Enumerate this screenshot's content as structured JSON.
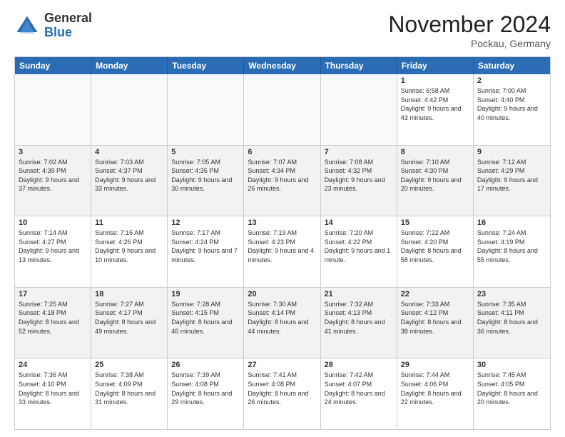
{
  "logo": {
    "general": "General",
    "blue": "Blue"
  },
  "title": "November 2024",
  "location": "Pockau, Germany",
  "days": [
    "Sunday",
    "Monday",
    "Tuesday",
    "Wednesday",
    "Thursday",
    "Friday",
    "Saturday"
  ],
  "weeks": [
    [
      {
        "day": "",
        "empty": true
      },
      {
        "day": "",
        "empty": true
      },
      {
        "day": "",
        "empty": true
      },
      {
        "day": "",
        "empty": true
      },
      {
        "day": "",
        "empty": true
      },
      {
        "day": "1",
        "sunrise": "6:58 AM",
        "sunset": "4:42 PM",
        "daylight": "9 hours and 43 minutes."
      },
      {
        "day": "2",
        "sunrise": "7:00 AM",
        "sunset": "4:40 PM",
        "daylight": "9 hours and 40 minutes."
      }
    ],
    [
      {
        "day": "3",
        "sunrise": "7:02 AM",
        "sunset": "4:39 PM",
        "daylight": "9 hours and 37 minutes."
      },
      {
        "day": "4",
        "sunrise": "7:03 AM",
        "sunset": "4:37 PM",
        "daylight": "9 hours and 33 minutes."
      },
      {
        "day": "5",
        "sunrise": "7:05 AM",
        "sunset": "4:35 PM",
        "daylight": "9 hours and 30 minutes."
      },
      {
        "day": "6",
        "sunrise": "7:07 AM",
        "sunset": "4:34 PM",
        "daylight": "9 hours and 26 minutes."
      },
      {
        "day": "7",
        "sunrise": "7:08 AM",
        "sunset": "4:32 PM",
        "daylight": "9 hours and 23 minutes."
      },
      {
        "day": "8",
        "sunrise": "7:10 AM",
        "sunset": "4:30 PM",
        "daylight": "9 hours and 20 minutes."
      },
      {
        "day": "9",
        "sunrise": "7:12 AM",
        "sunset": "4:29 PM",
        "daylight": "9 hours and 17 minutes."
      }
    ],
    [
      {
        "day": "10",
        "sunrise": "7:14 AM",
        "sunset": "4:27 PM",
        "daylight": "9 hours and 13 minutes."
      },
      {
        "day": "11",
        "sunrise": "7:15 AM",
        "sunset": "4:26 PM",
        "daylight": "9 hours and 10 minutes."
      },
      {
        "day": "12",
        "sunrise": "7:17 AM",
        "sunset": "4:24 PM",
        "daylight": "9 hours and 7 minutes."
      },
      {
        "day": "13",
        "sunrise": "7:19 AM",
        "sunset": "4:23 PM",
        "daylight": "9 hours and 4 minutes."
      },
      {
        "day": "14",
        "sunrise": "7:20 AM",
        "sunset": "4:22 PM",
        "daylight": "9 hours and 1 minute."
      },
      {
        "day": "15",
        "sunrise": "7:22 AM",
        "sunset": "4:20 PM",
        "daylight": "8 hours and 58 minutes."
      },
      {
        "day": "16",
        "sunrise": "7:24 AM",
        "sunset": "4:19 PM",
        "daylight": "8 hours and 55 minutes."
      }
    ],
    [
      {
        "day": "17",
        "sunrise": "7:25 AM",
        "sunset": "4:18 PM",
        "daylight": "8 hours and 52 minutes."
      },
      {
        "day": "18",
        "sunrise": "7:27 AM",
        "sunset": "4:17 PM",
        "daylight": "8 hours and 49 minutes."
      },
      {
        "day": "19",
        "sunrise": "7:28 AM",
        "sunset": "4:15 PM",
        "daylight": "8 hours and 46 minutes."
      },
      {
        "day": "20",
        "sunrise": "7:30 AM",
        "sunset": "4:14 PM",
        "daylight": "8 hours and 44 minutes."
      },
      {
        "day": "21",
        "sunrise": "7:32 AM",
        "sunset": "4:13 PM",
        "daylight": "8 hours and 41 minutes."
      },
      {
        "day": "22",
        "sunrise": "7:33 AM",
        "sunset": "4:12 PM",
        "daylight": "8 hours and 38 minutes."
      },
      {
        "day": "23",
        "sunrise": "7:35 AM",
        "sunset": "4:11 PM",
        "daylight": "8 hours and 36 minutes."
      }
    ],
    [
      {
        "day": "24",
        "sunrise": "7:36 AM",
        "sunset": "4:10 PM",
        "daylight": "8 hours and 33 minutes."
      },
      {
        "day": "25",
        "sunrise": "7:38 AM",
        "sunset": "4:09 PM",
        "daylight": "8 hours and 31 minutes."
      },
      {
        "day": "26",
        "sunrise": "7:39 AM",
        "sunset": "4:08 PM",
        "daylight": "8 hours and 29 minutes."
      },
      {
        "day": "27",
        "sunrise": "7:41 AM",
        "sunset": "4:08 PM",
        "daylight": "8 hours and 26 minutes."
      },
      {
        "day": "28",
        "sunrise": "7:42 AM",
        "sunset": "4:07 PM",
        "daylight": "8 hours and 24 minutes."
      },
      {
        "day": "29",
        "sunrise": "7:44 AM",
        "sunset": "4:06 PM",
        "daylight": "8 hours and 22 minutes."
      },
      {
        "day": "30",
        "sunrise": "7:45 AM",
        "sunset": "4:05 PM",
        "daylight": "8 hours and 20 minutes."
      }
    ]
  ]
}
